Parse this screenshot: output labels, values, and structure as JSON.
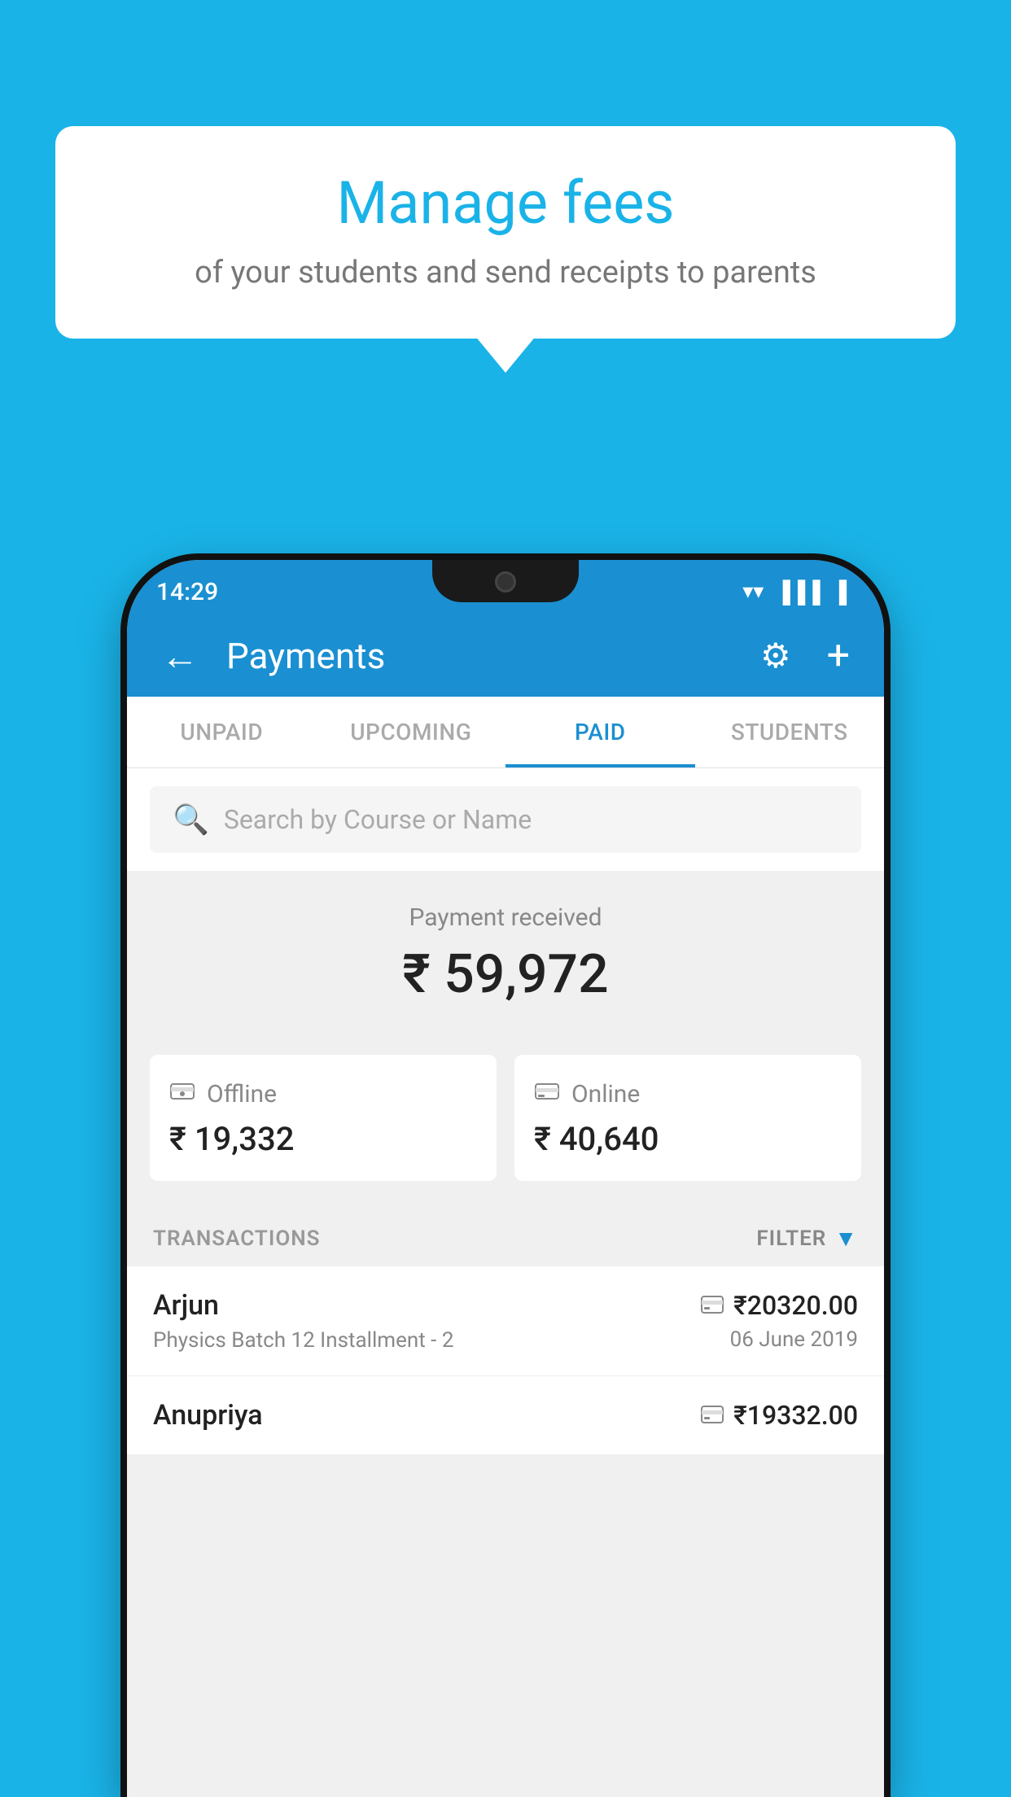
{
  "background_color": "#1ab3e8",
  "speech_bubble": {
    "title": "Manage fees",
    "subtitle": "of your students and send receipts to parents"
  },
  "status_bar": {
    "time": "14:29",
    "wifi": "▼",
    "signal": "▲",
    "battery": "▐"
  },
  "header": {
    "title": "Payments",
    "back_label": "←",
    "gear_label": "⚙",
    "plus_label": "+"
  },
  "tabs": [
    {
      "label": "UNPAID",
      "active": false
    },
    {
      "label": "UPCOMING",
      "active": false
    },
    {
      "label": "PAID",
      "active": true
    },
    {
      "label": "STUDENTS",
      "active": false
    }
  ],
  "search": {
    "placeholder": "Search by Course or Name"
  },
  "payment_received": {
    "label": "Payment received",
    "amount": "₹ 59,972"
  },
  "payment_cards": [
    {
      "icon": "offline",
      "label": "Offline",
      "amount": "₹ 19,332"
    },
    {
      "icon": "online",
      "label": "Online",
      "amount": "₹ 40,640"
    }
  ],
  "transactions": {
    "label": "TRANSACTIONS",
    "filter_label": "FILTER"
  },
  "transaction_rows": [
    {
      "name": "Arjun",
      "details": "Physics Batch 12 Installment - 2",
      "icon": "card",
      "amount": "₹20320.00",
      "date": "06 June 2019"
    },
    {
      "name": "Anupriya",
      "details": "",
      "icon": "cash",
      "amount": "₹19332.00",
      "date": ""
    }
  ]
}
